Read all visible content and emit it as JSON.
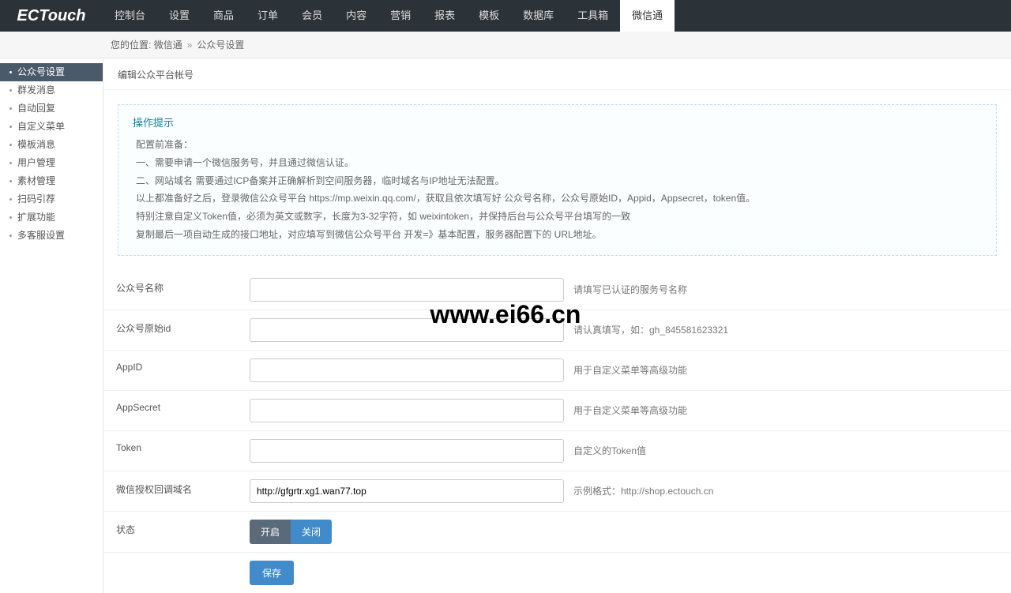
{
  "logo": "ECTouch",
  "topnav": [
    {
      "label": "控制台"
    },
    {
      "label": "设置"
    },
    {
      "label": "商品"
    },
    {
      "label": "订单"
    },
    {
      "label": "会员"
    },
    {
      "label": "内容"
    },
    {
      "label": "营销"
    },
    {
      "label": "报表"
    },
    {
      "label": "模板"
    },
    {
      "label": "数据库"
    },
    {
      "label": "工具箱"
    },
    {
      "label": "微信通",
      "active": true
    }
  ],
  "breadcrumb": {
    "prefix": "您的位置:",
    "path1": "微信通",
    "path2": "公众号设置"
  },
  "sidebar": [
    {
      "label": "公众号设置",
      "active": true
    },
    {
      "label": "群发消息"
    },
    {
      "label": "自动回复"
    },
    {
      "label": "自定义菜单"
    },
    {
      "label": "模板消息"
    },
    {
      "label": "用户管理"
    },
    {
      "label": "素材管理"
    },
    {
      "label": "扫码引荐"
    },
    {
      "label": "扩展功能"
    },
    {
      "label": "多客服设置"
    }
  ],
  "main": {
    "title": "编辑公众平台帐号"
  },
  "hint": {
    "title": "操作提示",
    "lines": [
      "配置前准备：",
      "一、需要申请一个微信服务号，并且通过微信认证。",
      "二、网站域名 需要通过ICP备案并正确解析到空间服务器，临时域名与IP地址无法配置。",
      "以上都准备好之后，登录微信公众号平台 https://mp.weixin.qq.com/，获取且依次填写好 公众号名称，公众号原始ID，Appid，Appsecret，token值。",
      "特别注意自定义Token值，必须为英文或数字，长度为3-32字符，如 weixintoken，并保持后台与公众号平台填写的一致",
      "复制最后一项自动生成的接口地址，对应填写到微信公众号平台 开发=》基本配置，服务器配置下的 URL地址。"
    ]
  },
  "form": {
    "name_label": "公众号名称",
    "name_value": "",
    "name_help": "请填写已认证的服务号名称",
    "orig_label": "公众号原始id",
    "orig_value": "",
    "orig_help": "请认真填写，如：gh_845581623321",
    "appid_label": "AppID",
    "appid_value": "",
    "appid_help": "用于自定义菜单等高级功能",
    "secret_label": "AppSecret",
    "secret_value": "",
    "secret_help": "用于自定义菜单等高级功能",
    "token_label": "Token",
    "token_value": "",
    "token_help": "自定义的Token值",
    "callback_label": "微信授权回调域名",
    "callback_value": "http://gfgrtr.xg1.wan77.top",
    "callback_help": "示例格式：http://shop.ectouch.cn",
    "status_label": "状态",
    "status_on": "开启",
    "status_off": "关闭",
    "save": "保存"
  },
  "watermark": "www.ei66.cn"
}
